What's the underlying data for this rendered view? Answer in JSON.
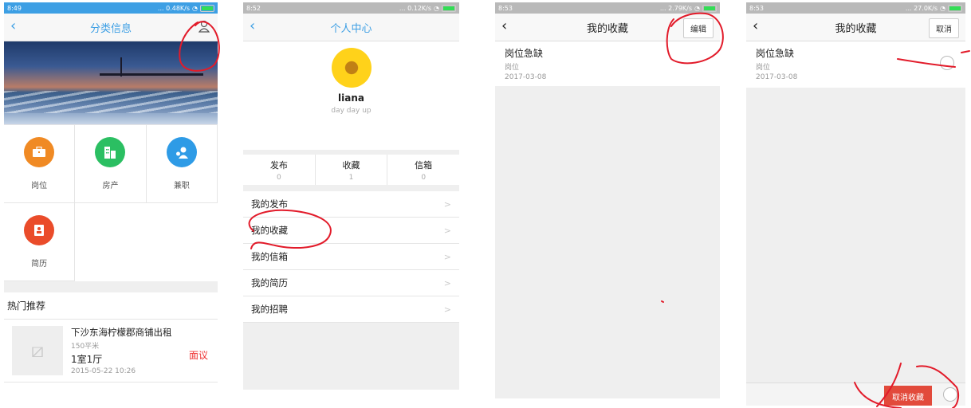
{
  "colors": {
    "accent": "#3d9fe4",
    "price": "#e33333",
    "annotation": "#e21b2a",
    "orange": "#f08a24",
    "green": "#2bbf62",
    "blue": "#2e9be6",
    "red": "#ea4c2a"
  },
  "screen1": {
    "status": {
      "time": "8:49",
      "net": "... 0.48K/s"
    },
    "title": "分类信息",
    "categories": [
      {
        "label": "岗位",
        "icon": "briefcase-icon"
      },
      {
        "label": "房产",
        "icon": "building-icon"
      },
      {
        "label": "兼职",
        "icon": "person-icon"
      },
      {
        "label": "简历",
        "icon": "resume-icon"
      }
    ],
    "hot_title": "热门推荐",
    "listing": {
      "title": "下沙东海柠檬郡商铺出租",
      "area": "150平米",
      "layout": "1室1厅",
      "date": "2015-05-22 10:26",
      "price": "面议"
    }
  },
  "screen2": {
    "status": {
      "time": "8:52",
      "net": "... 0.12K/s"
    },
    "title": "个人中心",
    "username": "liana",
    "motto": "day day up",
    "stats": [
      {
        "label": "发布",
        "value": "0"
      },
      {
        "label": "收藏",
        "value": "1"
      },
      {
        "label": "信箱",
        "value": "0"
      }
    ],
    "menu": [
      "我的发布",
      "我的收藏",
      "我的信箱",
      "我的简历",
      "我的招聘"
    ]
  },
  "screen3": {
    "status": {
      "time": "8:53",
      "net": "... 2.79K/s"
    },
    "title": "我的收藏",
    "edit": "编辑",
    "item": {
      "title": "岗位急缺",
      "category": "岗位",
      "date": "2017-03-08"
    }
  },
  "screen4": {
    "status": {
      "time": "8:53",
      "net": "... 27.0K/s"
    },
    "title": "我的收藏",
    "cancel": "取消",
    "item": {
      "title": "岗位急缺",
      "category": "岗位",
      "date": "2017-03-08"
    },
    "unfavorite": "取消收藏"
  }
}
